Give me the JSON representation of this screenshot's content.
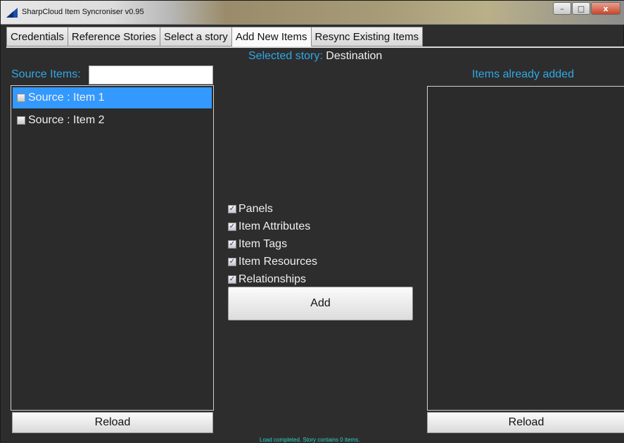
{
  "window": {
    "title": "SharpCloud Item Syncroniser v0.95",
    "controls": {
      "minimize": "–",
      "maximize": "□",
      "close": "x"
    }
  },
  "tabs": [
    {
      "label": "Credentials",
      "active": false
    },
    {
      "label": "Reference Stories",
      "active": false
    },
    {
      "label": "Select a story",
      "active": false
    },
    {
      "label": "Add New Items",
      "active": true
    },
    {
      "label": "Resync Existing Items",
      "active": false
    }
  ],
  "selected_story": {
    "prefix": "Selected story:",
    "name": "Destination"
  },
  "source": {
    "label": "Source Items:",
    "search_value": "",
    "items": [
      {
        "label": "Source :  Item 1",
        "checked": false,
        "selected": true
      },
      {
        "label": "Source :  Item 2",
        "checked": false,
        "selected": false
      }
    ],
    "reload_label": "Reload"
  },
  "options": [
    {
      "label": "Panels",
      "checked": true
    },
    {
      "label": "Item Attributes",
      "checked": true
    },
    {
      "label": "Item Tags",
      "checked": true
    },
    {
      "label": "Item Resources",
      "checked": true
    },
    {
      "label": "Relationships",
      "checked": true
    }
  ],
  "add_label": "Add",
  "added": {
    "label": "Items already added",
    "reload_label": "Reload"
  },
  "status": "Load completed. Story contains 0 items.",
  "colors": {
    "accent": "#2fa8e6",
    "selection": "#3399ff",
    "status": "#2fd2c8",
    "background": "#2d2d2d"
  },
  "icons": {
    "app": "sharpcloud-logo-icon",
    "checkbox_checked": "check-icon"
  }
}
